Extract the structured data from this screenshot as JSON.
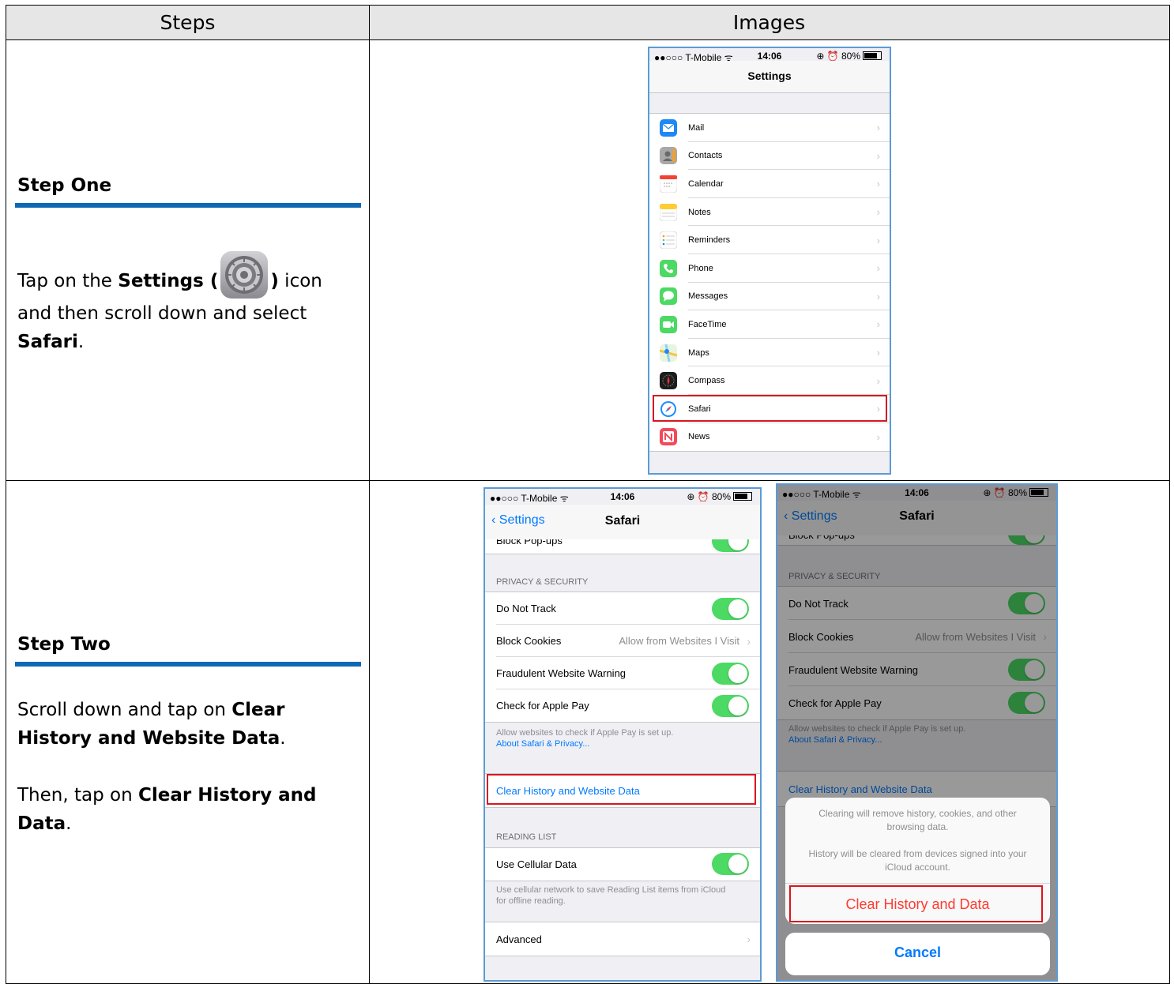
{
  "table": {
    "header_steps": "Steps",
    "header_images": "Images"
  },
  "step_one": {
    "title": "Step One",
    "text_a": "Tap on the ",
    "text_b": "Settings (",
    "text_c": ")",
    "text_d": " icon and then scroll down and select ",
    "text_e": "Safari",
    "text_f": "."
  },
  "step_two": {
    "title": "Step Two",
    "p1_a": "Scroll down and tap on ",
    "p1_b": "Clear History and Website Data",
    "p1_c": ".",
    "p2_a": "Then, tap on ",
    "p2_b": "Clear History and Data",
    "p2_c": "."
  },
  "status_bar": {
    "carrier": "●●○○○ T-Mobile ᯤ",
    "time": "14:06",
    "battery": "⊕ ⏰ 80%"
  },
  "settings_screen": {
    "title": "Settings",
    "items": [
      {
        "label": "Mail",
        "icon": "mail-icon",
        "color": "#1e88f5"
      },
      {
        "label": "Contacts",
        "icon": "contacts-icon",
        "color": "#9a9a9a"
      },
      {
        "label": "Calendar",
        "icon": "calendar-icon",
        "color": "#ffffff"
      },
      {
        "label": "Notes",
        "icon": "notes-icon",
        "color": "#ffd54a"
      },
      {
        "label": "Reminders",
        "icon": "reminders-icon",
        "color": "#ffffff"
      },
      {
        "label": "Phone",
        "icon": "phone-icon",
        "color": "#4cd964"
      },
      {
        "label": "Messages",
        "icon": "messages-icon",
        "color": "#4cd964"
      },
      {
        "label": "FaceTime",
        "icon": "facetime-icon",
        "color": "#4cd964"
      },
      {
        "label": "Maps",
        "icon": "maps-icon",
        "color": "#8fd3f4"
      },
      {
        "label": "Compass",
        "icon": "compass-icon",
        "color": "#1c1c1c"
      },
      {
        "label": "Safari",
        "icon": "safari-icon",
        "color": "#1a8cff"
      },
      {
        "label": "News",
        "icon": "news-icon",
        "color": "#f2495b"
      }
    ]
  },
  "safari_screen": {
    "back_label": "Settings",
    "title": "Safari",
    "block_popups": "Block Pop-ups",
    "privacy_header": "PRIVACY & SECURITY",
    "do_not_track": "Do Not Track",
    "block_cookies": "Block Cookies",
    "block_cookies_value": "Allow from Websites I Visit",
    "fraud_warning": "Fraudulent Website Warning",
    "apple_pay": "Check for Apple Pay",
    "pay_note": "Allow websites to check if Apple Pay is set up.",
    "privacy_link": "About Safari & Privacy...",
    "clear_history": "Clear History and Website Data",
    "reading_header": "READING LIST",
    "cellular": "Use Cellular Data",
    "cellular_note_1": "Use cellular network to save Reading List items from iCloud",
    "cellular_note_2": "for offline reading.",
    "advanced": "Advanced"
  },
  "confirm_sheet": {
    "msg1_line1": "Clearing will remove history, cookies, and other",
    "msg1_line2": "browsing data.",
    "msg2_line1": "History will be cleared from devices signed into your",
    "msg2_line2": "iCloud account.",
    "clear_button": "Clear History and Data",
    "cancel_button": "Cancel",
    "clear_color": "#ff3b30",
    "cancel_color": "#007aff"
  }
}
